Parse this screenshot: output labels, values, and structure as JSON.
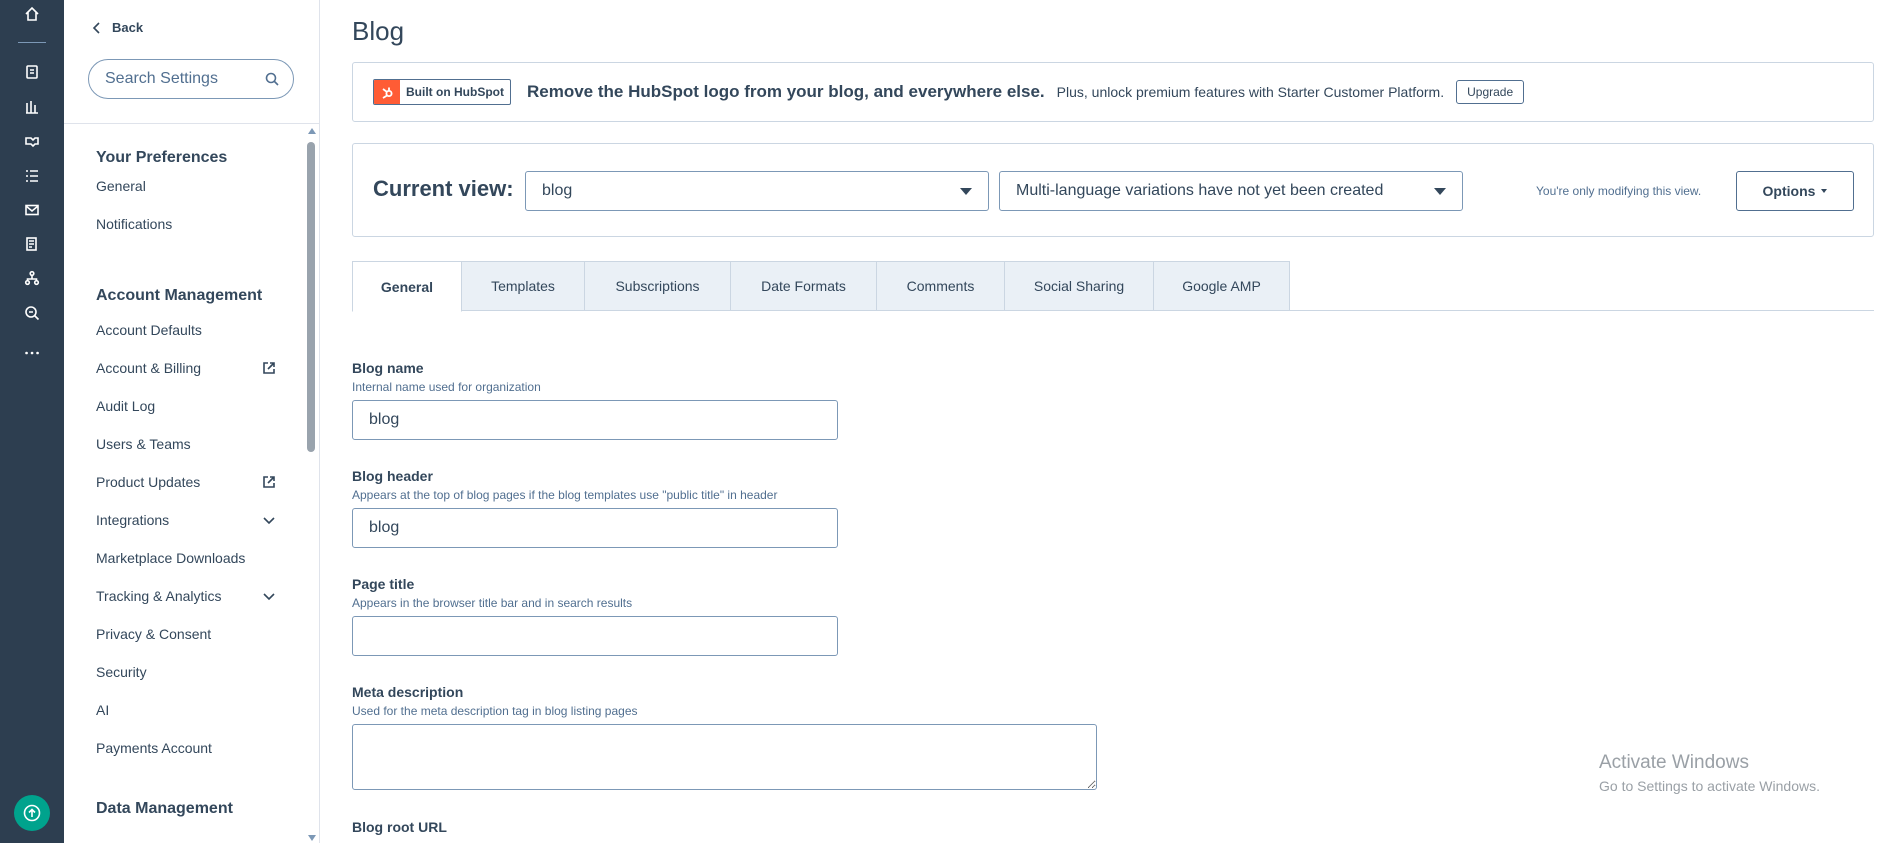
{
  "rail": {
    "icons": [
      "home-icon",
      "contacts-icon",
      "marketing-icon",
      "sales-icon",
      "service-icon",
      "email-icon",
      "content-icon",
      "automation-icon",
      "reporting-icon",
      "more-icon"
    ],
    "help_icon": "help-icon"
  },
  "sidebar": {
    "back_label": "Back",
    "search_placeholder": "Search Settings",
    "sections": [
      {
        "heading": "Your Preferences",
        "items": [
          {
            "label": "General"
          },
          {
            "label": "Notifications"
          }
        ]
      },
      {
        "heading": "Account Management",
        "items": [
          {
            "label": "Account Defaults"
          },
          {
            "label": "Account & Billing",
            "trail": "external-link-icon"
          },
          {
            "label": "Audit Log"
          },
          {
            "label": "Users & Teams"
          },
          {
            "label": "Product Updates",
            "trail": "external-link-icon"
          },
          {
            "label": "Integrations",
            "trail": "chevron-down-icon"
          },
          {
            "label": "Marketplace Downloads"
          },
          {
            "label": "Tracking & Analytics",
            "trail": "chevron-down-icon"
          },
          {
            "label": "Privacy & Consent"
          },
          {
            "label": "Security"
          },
          {
            "label": "AI"
          },
          {
            "label": "Payments Account"
          }
        ]
      },
      {
        "heading": "Data Management",
        "items": []
      }
    ]
  },
  "main": {
    "title": "Blog",
    "banner": {
      "badge_text": "Built on HubSpot",
      "headline": "Remove the HubSpot logo from your blog, and everywhere else.",
      "subtext": "Plus, unlock premium features with Starter Customer Platform.",
      "upgrade_label": "Upgrade"
    },
    "view": {
      "label": "Current view:",
      "blog_select": "blog",
      "language_select": "Multi-language variations have not yet been created",
      "note": "You're only modifying this view.",
      "options_label": "Options"
    },
    "tabs": [
      {
        "label": "General",
        "active": true
      },
      {
        "label": "Templates"
      },
      {
        "label": "Subscriptions"
      },
      {
        "label": "Date Formats"
      },
      {
        "label": "Comments"
      },
      {
        "label": "Social Sharing"
      },
      {
        "label": "Google AMP"
      }
    ],
    "fields": {
      "blog_name": {
        "label": "Blog name",
        "help": "Internal name used for organization",
        "value": "blog"
      },
      "blog_header": {
        "label": "Blog header",
        "help": "Appears at the top of blog pages if the blog templates use \"public title\" in header",
        "value": "blog"
      },
      "page_title": {
        "label": "Page title",
        "help": "Appears in the browser title bar and in search results",
        "value": ""
      },
      "meta_description": {
        "label": "Meta description",
        "help": "Used for the meta description tag in blog listing pages",
        "value": ""
      },
      "blog_root_url": {
        "label": "Blog root URL"
      }
    }
  },
  "watermark": {
    "line1": "Activate Windows",
    "line2": "Go to Settings to activate Windows."
  },
  "colors": {
    "rail_bg": "#2d3e50",
    "hubspot_orange": "#ff5c35",
    "help_teal": "#00a38d",
    "text": "#33475b",
    "border": "#cbd6e2"
  }
}
